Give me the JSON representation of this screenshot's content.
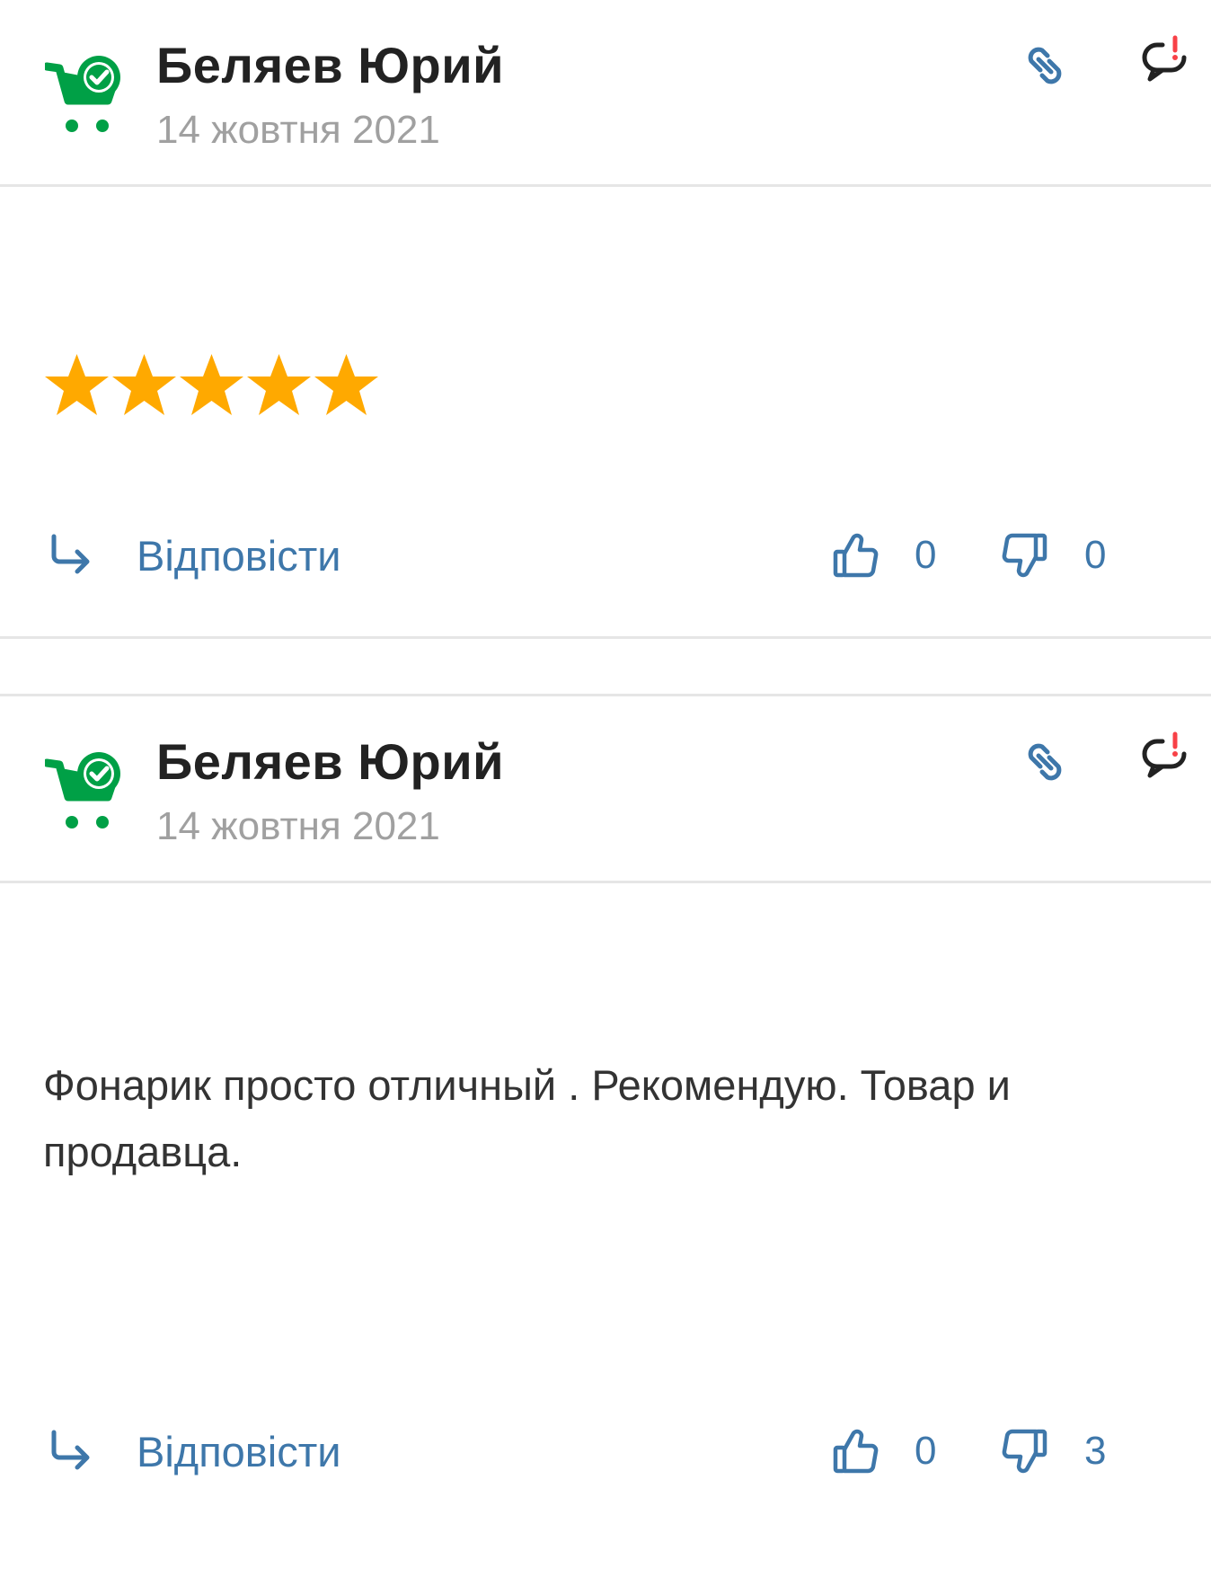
{
  "reviews": [
    {
      "author": "Беляев Юрий",
      "date": "14 жовтня 2021",
      "rating": 5,
      "rating_max": 5,
      "text": "",
      "reply_label": "Відповісти",
      "likes": "0",
      "dislikes": "0"
    },
    {
      "author": "Беляев Юрий",
      "date": "14 жовтня 2021",
      "text": "Фонарик просто отличный . Рекомендую. Товар и продавца.",
      "reply_label": "Відповісти",
      "likes": "0",
      "dislikes": "3"
    }
  ],
  "icons": {
    "avatar": "verified-buyer-cart-icon",
    "link": "link-icon",
    "report": "report-complaint-icon",
    "reply": "reply-arrow-icon",
    "like": "thumbs-up-icon",
    "dislike": "thumbs-down-icon",
    "star": "star-icon"
  },
  "colors": {
    "accent": "#3e77aa",
    "verified_green": "#00a046",
    "star": "#ffa900",
    "report_red": "#f84147",
    "date_gray": "#a0a0a0"
  }
}
